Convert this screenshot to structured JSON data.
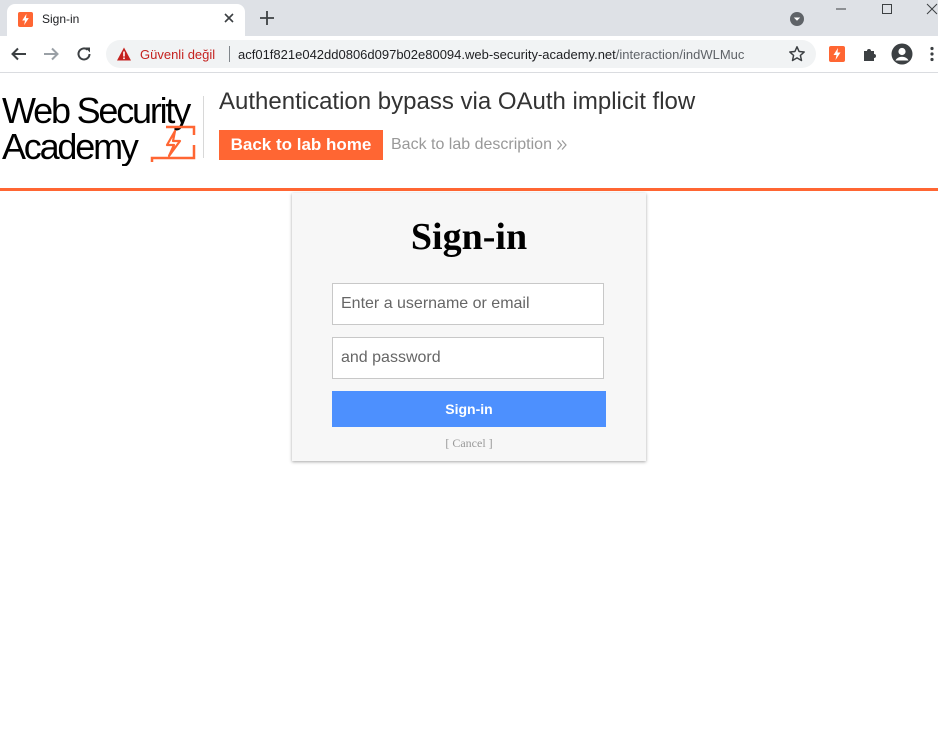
{
  "browser": {
    "tab": {
      "title": "Sign-in",
      "favicon": "portswigger-favicon"
    },
    "address_bar": {
      "security_label": "Güvenli değil",
      "url_host": "acf01f821e042dd0806d097b02e80094.web-security-academy.net",
      "url_path": "/interaction/indWLMuc"
    },
    "colors": {
      "tabstrip": "#dee1e6",
      "insecure": "#c5221f"
    }
  },
  "header": {
    "logo": {
      "line1": "Web Security",
      "line2": "Academy"
    },
    "lab_title": "Authentication bypass via OAuth implicit flow",
    "back_home_label": "Back to lab home",
    "back_description_label": "Back to lab description",
    "accent_color": "#ff6633"
  },
  "login": {
    "title": "Sign-in",
    "username_placeholder": "Enter a username or email",
    "password_placeholder": "and password",
    "submit_label": "Sign-in",
    "cancel_label": "[ Cancel ]",
    "button_color": "#4d90fe"
  }
}
